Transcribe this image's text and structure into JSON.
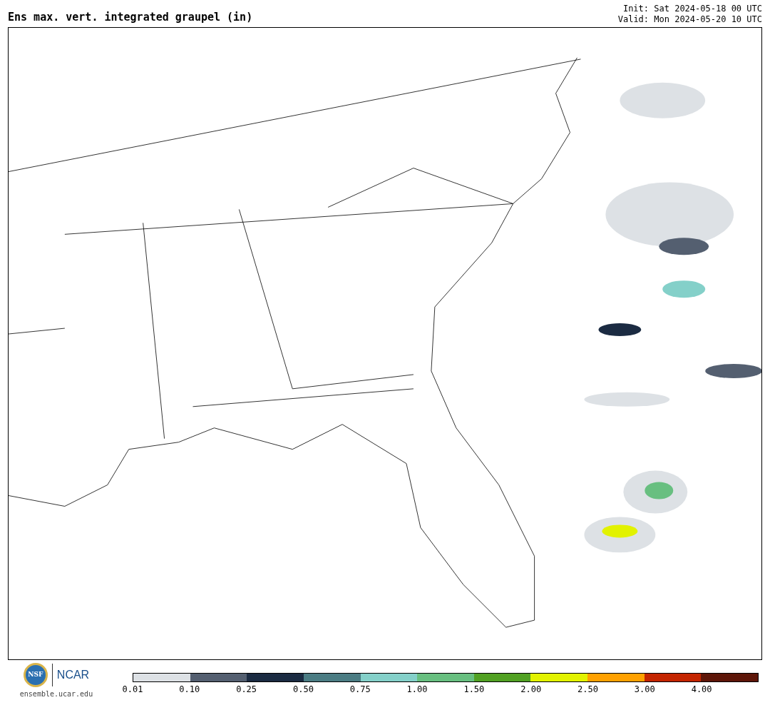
{
  "title": "Ens max. vert. integrated graupel (in)",
  "init": "Init: Sat 2024-05-18 00 UTC",
  "valid": "Valid: Mon 2024-05-20 10 UTC",
  "logos": {
    "nsf": "NSF",
    "ncar": "NCAR",
    "site": "ensemble.ucar.edu"
  },
  "colorbar": [
    {
      "label": "0.01",
      "color": "#dde1e5"
    },
    {
      "label": "0.10",
      "color": "#545f70"
    },
    {
      "label": "0.25",
      "color": "#1b2b42"
    },
    {
      "label": "0.50",
      "color": "#4b7c83"
    },
    {
      "label": "0.75",
      "color": "#84d0c9"
    },
    {
      "label": "1.00",
      "color": "#68bf80"
    },
    {
      "label": "1.50",
      "color": "#51a123"
    },
    {
      "label": "2.00",
      "color": "#e2f200"
    },
    {
      "label": "2.50",
      "color": "#ffa100"
    },
    {
      "label": "3.00",
      "color": "#c42500"
    },
    {
      "label": "4.00",
      "color": "#5e1609"
    }
  ]
}
